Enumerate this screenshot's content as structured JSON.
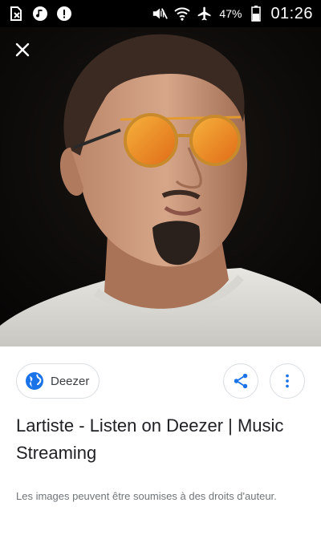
{
  "status_bar": {
    "left_icons": [
      "sim-off-icon",
      "music-note-icon",
      "notification-alert-icon"
    ],
    "right_icons": [
      "mute-icon",
      "wifi-icon",
      "airplane-icon",
      "battery-icon"
    ],
    "battery": "47%",
    "time": "01:26"
  },
  "viewer": {
    "close_icon": "close-icon"
  },
  "card": {
    "source_label": "Deezer",
    "share_icon": "share-icon",
    "more_icon": "more-vertical-icon",
    "title": "Lartiste - Listen on Deezer | Music Streaming",
    "copyright": "Les images peuvent être soumises à des droits d'auteur."
  },
  "colors": {
    "status_bg": "#000000",
    "viewer_bg": "#0b0a09",
    "accent_blue": "#1a73e8",
    "title_text": "#202124",
    "muted_text": "#70757a",
    "border": "#d9dde2"
  }
}
